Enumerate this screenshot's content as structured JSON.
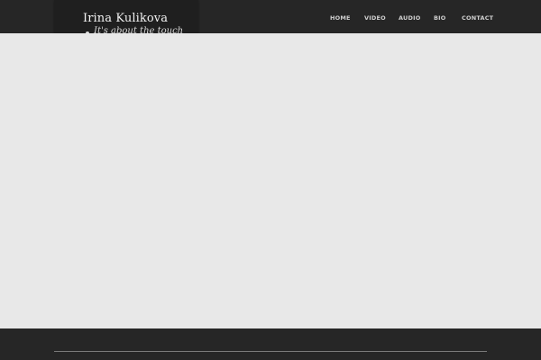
{
  "header": {
    "logo": {
      "name": "Irina Kulikova",
      "tagline": "It's about the touch"
    },
    "nav": [
      {
        "label": "HOME"
      },
      {
        "label": "VIDEO"
      },
      {
        "label": "AUDIO"
      },
      {
        "label": "BIO"
      },
      {
        "label": "CONTACT"
      }
    ]
  },
  "colors": {
    "header_bg": "#262626",
    "logo_bg": "#1f1f1f",
    "content_bg": "#e8e8e8",
    "footer_bg": "#262626",
    "nav_text": "#d0d0d0"
  }
}
